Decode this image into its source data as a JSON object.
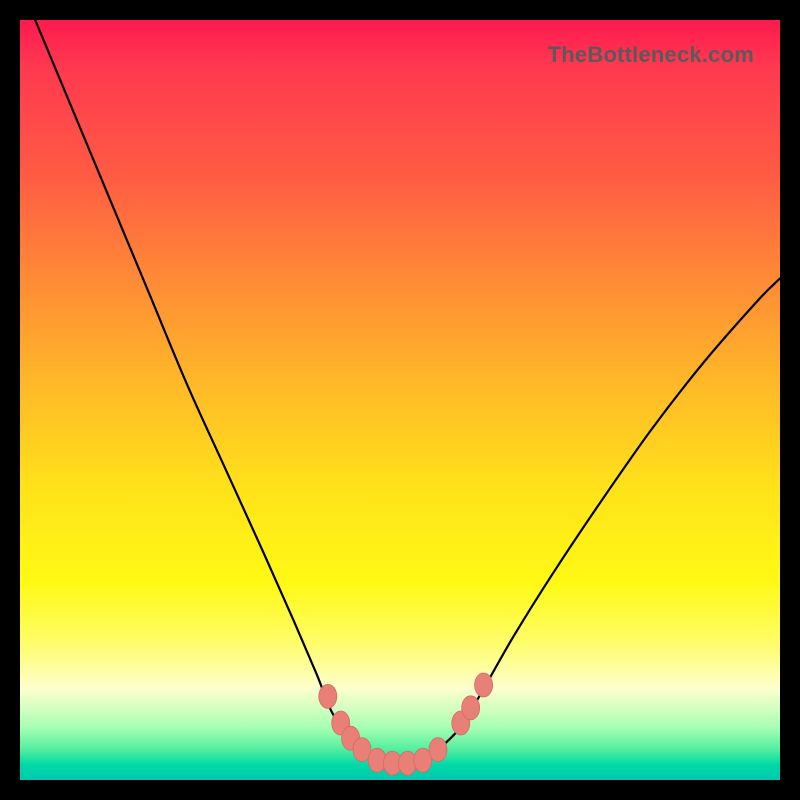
{
  "watermark": "TheBottleneck.com",
  "colors": {
    "frame": "#000000",
    "curve": "#000000",
    "marker_fill": "#e98077",
    "marker_stroke": "#d46b63",
    "gradient_top": "#ff1a4f",
    "gradient_bottom": "#00c9b0"
  },
  "chart_data": {
    "type": "line",
    "title": "",
    "xlabel": "",
    "ylabel": "",
    "xlim": [
      0,
      100
    ],
    "ylim": [
      0,
      100
    ],
    "grid": false,
    "legend": false,
    "series": [
      {
        "name": "curve",
        "x": [
          2,
          7,
          12,
          17,
          22,
          27,
          32,
          36,
          39,
          41,
          43,
          45,
          47,
          49,
          51,
          53,
          55,
          58,
          61,
          65,
          70,
          76,
          83,
          90,
          97,
          100
        ],
        "values": [
          100,
          88,
          76,
          64,
          52,
          41,
          30,
          21,
          14,
          9,
          6,
          4,
          2.6,
          2.0,
          2.0,
          2.6,
          4,
          7,
          12,
          19,
          27,
          36,
          46,
          55,
          63,
          66
        ]
      }
    ],
    "markers": [
      {
        "cluster": "left-upper",
        "x": 40.5,
        "y": 11.0
      },
      {
        "cluster": "left-mid",
        "x": 42.2,
        "y": 7.5
      },
      {
        "cluster": "left-mid",
        "x": 43.5,
        "y": 5.5
      },
      {
        "cluster": "left-low",
        "x": 45.0,
        "y": 4.0
      },
      {
        "cluster": "flat",
        "x": 47.0,
        "y": 2.6
      },
      {
        "cluster": "flat",
        "x": 49.0,
        "y": 2.2
      },
      {
        "cluster": "flat",
        "x": 51.0,
        "y": 2.2
      },
      {
        "cluster": "flat",
        "x": 53.0,
        "y": 2.6
      },
      {
        "cluster": "right-low",
        "x": 55.0,
        "y": 4.0
      },
      {
        "cluster": "right-mid",
        "x": 58.0,
        "y": 7.5
      },
      {
        "cluster": "right-mid",
        "x": 59.3,
        "y": 9.5
      },
      {
        "cluster": "right-upper",
        "x": 61.0,
        "y": 12.5
      }
    ]
  }
}
